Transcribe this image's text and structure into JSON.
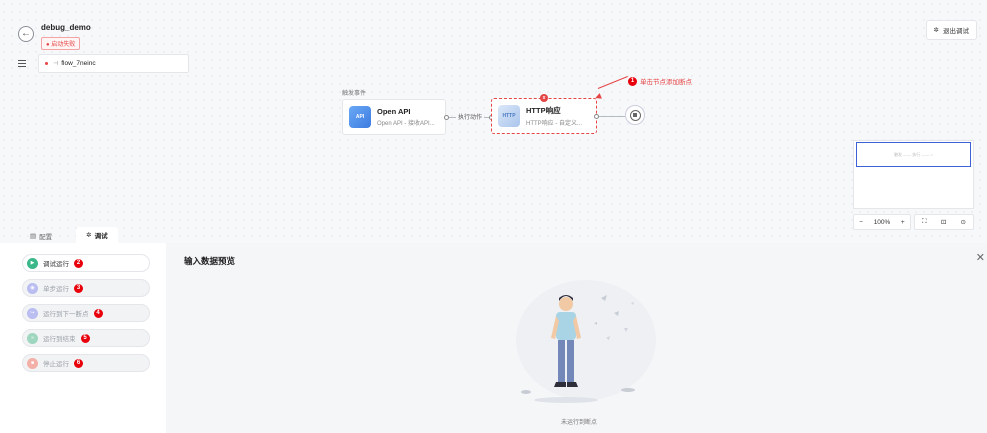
{
  "header": {
    "title": "debug_demo",
    "status_badge": "● 启动失败",
    "flow_name": "flow_7neinc",
    "exit_debug": "退出调试"
  },
  "canvas": {
    "trigger_label": "触发事件",
    "nodes": [
      {
        "title": "Open API",
        "subtitle": "Open API - 接收API...",
        "icon_text": "API"
      },
      {
        "title": "HTTP响应",
        "subtitle": "HTTP响应 - 自定义...",
        "icon_text": "HTTP"
      }
    ],
    "edge_label": "执行动作",
    "annotation": {
      "number": "1",
      "text": "单击节点添加断点"
    },
    "breakpoint_marker": "x",
    "minimap_text": "触发 —— 执行 —— ○",
    "zoom": {
      "minus": "−",
      "level": "100%",
      "plus": "+"
    }
  },
  "tabs": [
    {
      "label": "配置",
      "icon": "layout-icon"
    },
    {
      "label": "调试",
      "icon": "bug-icon"
    }
  ],
  "debug_actions": [
    {
      "label": "调试运行",
      "number": "2",
      "color": "#3bb88a",
      "disabled": false
    },
    {
      "label": "单步运行",
      "number": "3",
      "color": "#b9bdf0",
      "disabled": true
    },
    {
      "label": "运行到下一断点",
      "number": "4",
      "color": "#b9bdf0",
      "disabled": true
    },
    {
      "label": "运行到结束",
      "number": "5",
      "color": "#9fd6bf",
      "disabled": true
    },
    {
      "label": "停止运行",
      "number": "6",
      "color": "#f3b0a8",
      "disabled": true
    }
  ],
  "preview": {
    "title": "输入数据预览",
    "empty_text": "未运行到断点"
  },
  "colors": {
    "accent_red": "#e54545",
    "primary_blue": "#3c62d6",
    "run_green": "#3bb88a"
  }
}
